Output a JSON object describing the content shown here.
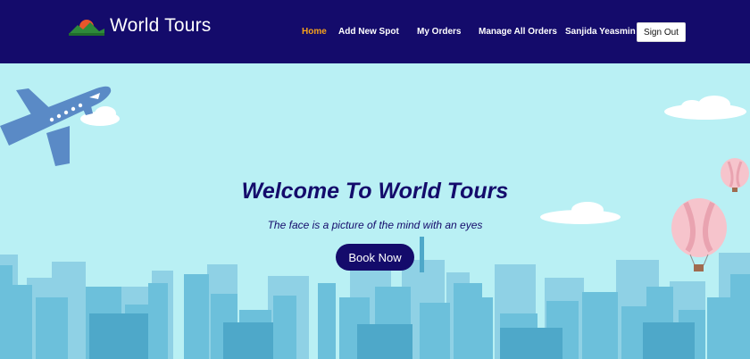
{
  "header": {
    "brand_name": "World Tours",
    "nav": [
      {
        "label": "Home",
        "active": true
      },
      {
        "label": "Add New Spot",
        "active": false
      },
      {
        "label": "My Orders",
        "active": false
      },
      {
        "label": "Manage All Orders",
        "active": false
      }
    ],
    "user_name": "Sanjida Yeasmin",
    "signout_label": "Sign Out"
  },
  "hero": {
    "title": "Welcome To World Tours",
    "subtitle": "The face is a picture of the mind with an eyes",
    "cta_label": "Book Now"
  },
  "colors": {
    "navbar": "#140b6b",
    "active_link": "#f7a21b",
    "sky": "#b9f0f4",
    "primary": "#140b6b"
  },
  "icons": {
    "logo": "mountain-sun-logo",
    "decor": [
      "airplane",
      "cloud",
      "hot-air-balloon",
      "city-skyline"
    ]
  }
}
